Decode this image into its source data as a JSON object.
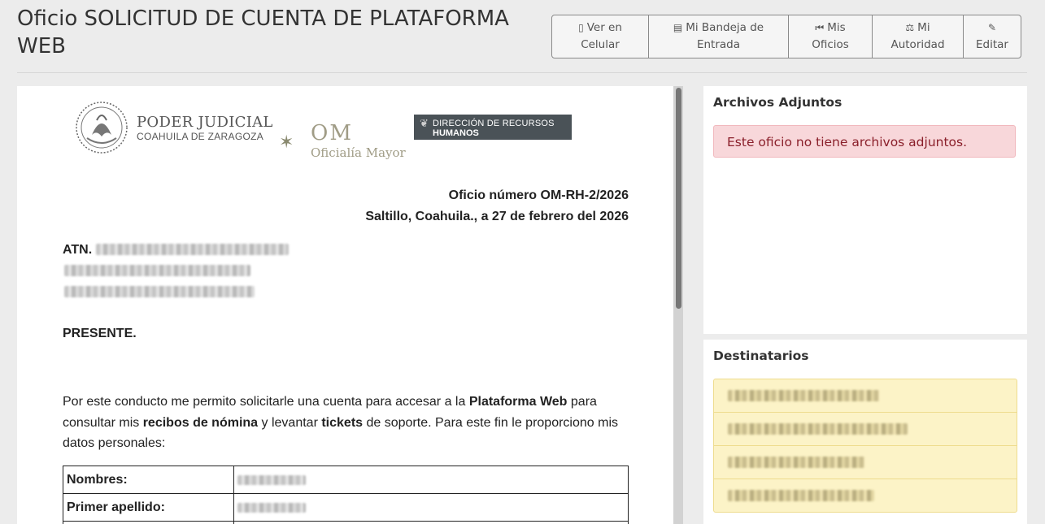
{
  "header": {
    "title": "Oficio SOLICITUD DE CUENTA DE PLATAFORMA WEB",
    "buttons": [
      {
        "icon": "mobile-phone-icon",
        "glyph": "▯",
        "label_line1": "Ver en",
        "label_line2": "Celular"
      },
      {
        "icon": "inbox-icon",
        "glyph": "▤",
        "label_line1": "Mi Bandeja de",
        "label_line2": "Entrada"
      },
      {
        "icon": "fast-backward-icon",
        "glyph": "⏮",
        "label_line1": "Mis",
        "label_line2": "Oficios"
      },
      {
        "icon": "scale-icon",
        "glyph": "⚖",
        "label_line1": "Mi",
        "label_line2": "Autoridad"
      },
      {
        "icon": "pencil-icon",
        "glyph": "✎",
        "label_line1": "",
        "label_line2": "Editar"
      }
    ]
  },
  "letterhead": {
    "institution": "PODER JUDICIAL",
    "state": "COAHUILA DE ZARAGOZA",
    "om_abbr": "OM",
    "om_name": "Oficialía Mayor",
    "dept_line1": "DIRECCIÓN DE RECURSOS",
    "dept_line2": "HUMANOS"
  },
  "document": {
    "oficio_number": "Oficio número OM-RH-2/2026",
    "place_date": "Saltillo, Coahuila., a 27 de febrero del 2026",
    "atn_label": "ATN.",
    "greeting": "PRESENTE.",
    "body_p1": "Por este conducto me permito solicitarle una cuenta para accesar a la ",
    "body_b1": "Plataforma Web",
    "body_p2": " para consultar mis ",
    "body_b2": "recibos de nómina",
    "body_p3": " y levantar ",
    "body_b3": "tickets",
    "body_p4": " de soporte. Para este fin le proporciono mis datos personales:",
    "table": [
      {
        "key": "Nombres:"
      },
      {
        "key": "Primer apellido:"
      },
      {
        "key": ""
      }
    ]
  },
  "attachments": {
    "title": "Archivos Adjuntos",
    "empty_message": "Este oficio no tiene archivos adjuntos."
  },
  "recipients": {
    "title": "Destinatarios",
    "count_shown": 4
  },
  "colors": {
    "alert_bg": "#f8d7da",
    "alert_text": "#8a1f2a",
    "recipients_bg": "#fcf3c7",
    "dept_box": "#4a5257"
  }
}
